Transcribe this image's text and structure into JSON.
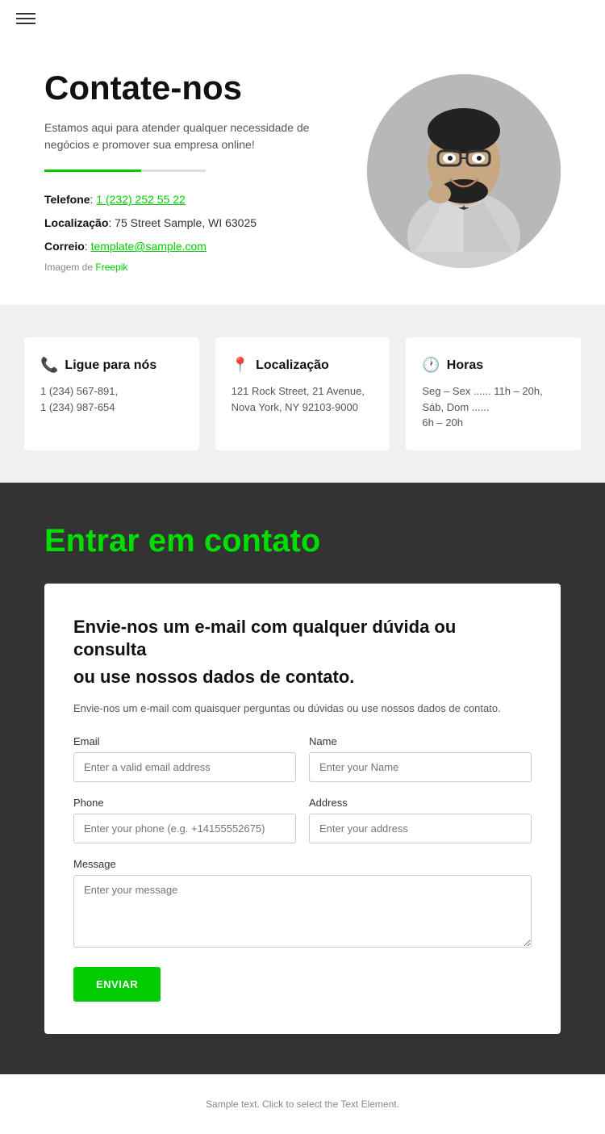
{
  "nav": {
    "hamburger_label": "menu"
  },
  "hero": {
    "title": "Contate-nos",
    "description": "Estamos aqui para atender qualquer necessidade de negócios e promover sua empresa online!",
    "phone_label": "Telefone",
    "phone_number": "1 (232) 252 55 22",
    "location_label": "Localização",
    "location_value": "75 Street Sample, WI 63025",
    "email_label": "Correio",
    "email_value": "template@sample.com",
    "image_credit_prefix": "Imagem de",
    "image_credit_link": "Freepik"
  },
  "cards": [
    {
      "icon": "📞",
      "icon_color": "#00cc00",
      "title": "Ligue para nós",
      "text": "1 (234) 567-891,\n1 (234) 987-654"
    },
    {
      "icon": "📍",
      "icon_color": "#00cc00",
      "title": "Localização",
      "text": "121 Rock Street, 21 Avenue, Nova York, NY 92103-9000"
    },
    {
      "icon": "🕐",
      "icon_color": "#00cc00",
      "title": "Horas",
      "text": "Seg – Sex ...... 11h – 20h, Sáb, Dom  ......\n6h – 20h"
    }
  ],
  "contact_section": {
    "title": "Entrar em contato",
    "form_heading_line1": "Envie-nos um e-mail com qualquer dúvida ou consulta",
    "form_heading_line2": "ou use nossos dados de contato.",
    "form_description": "Envie-nos um e-mail com quaisquer perguntas ou dúvidas ou use nossos dados de contato.",
    "form": {
      "email_label": "Email",
      "email_placeholder": "Enter a valid email address",
      "name_label": "Name",
      "name_placeholder": "Enter your Name",
      "phone_label": "Phone",
      "phone_placeholder": "Enter your phone (e.g. +14155552675)",
      "address_label": "Address",
      "address_placeholder": "Enter your address",
      "message_label": "Message",
      "message_placeholder": "Enter your message",
      "submit_label": "ENVIAR"
    }
  },
  "footer": {
    "text": "Sample text. Click to select the Text Element."
  }
}
